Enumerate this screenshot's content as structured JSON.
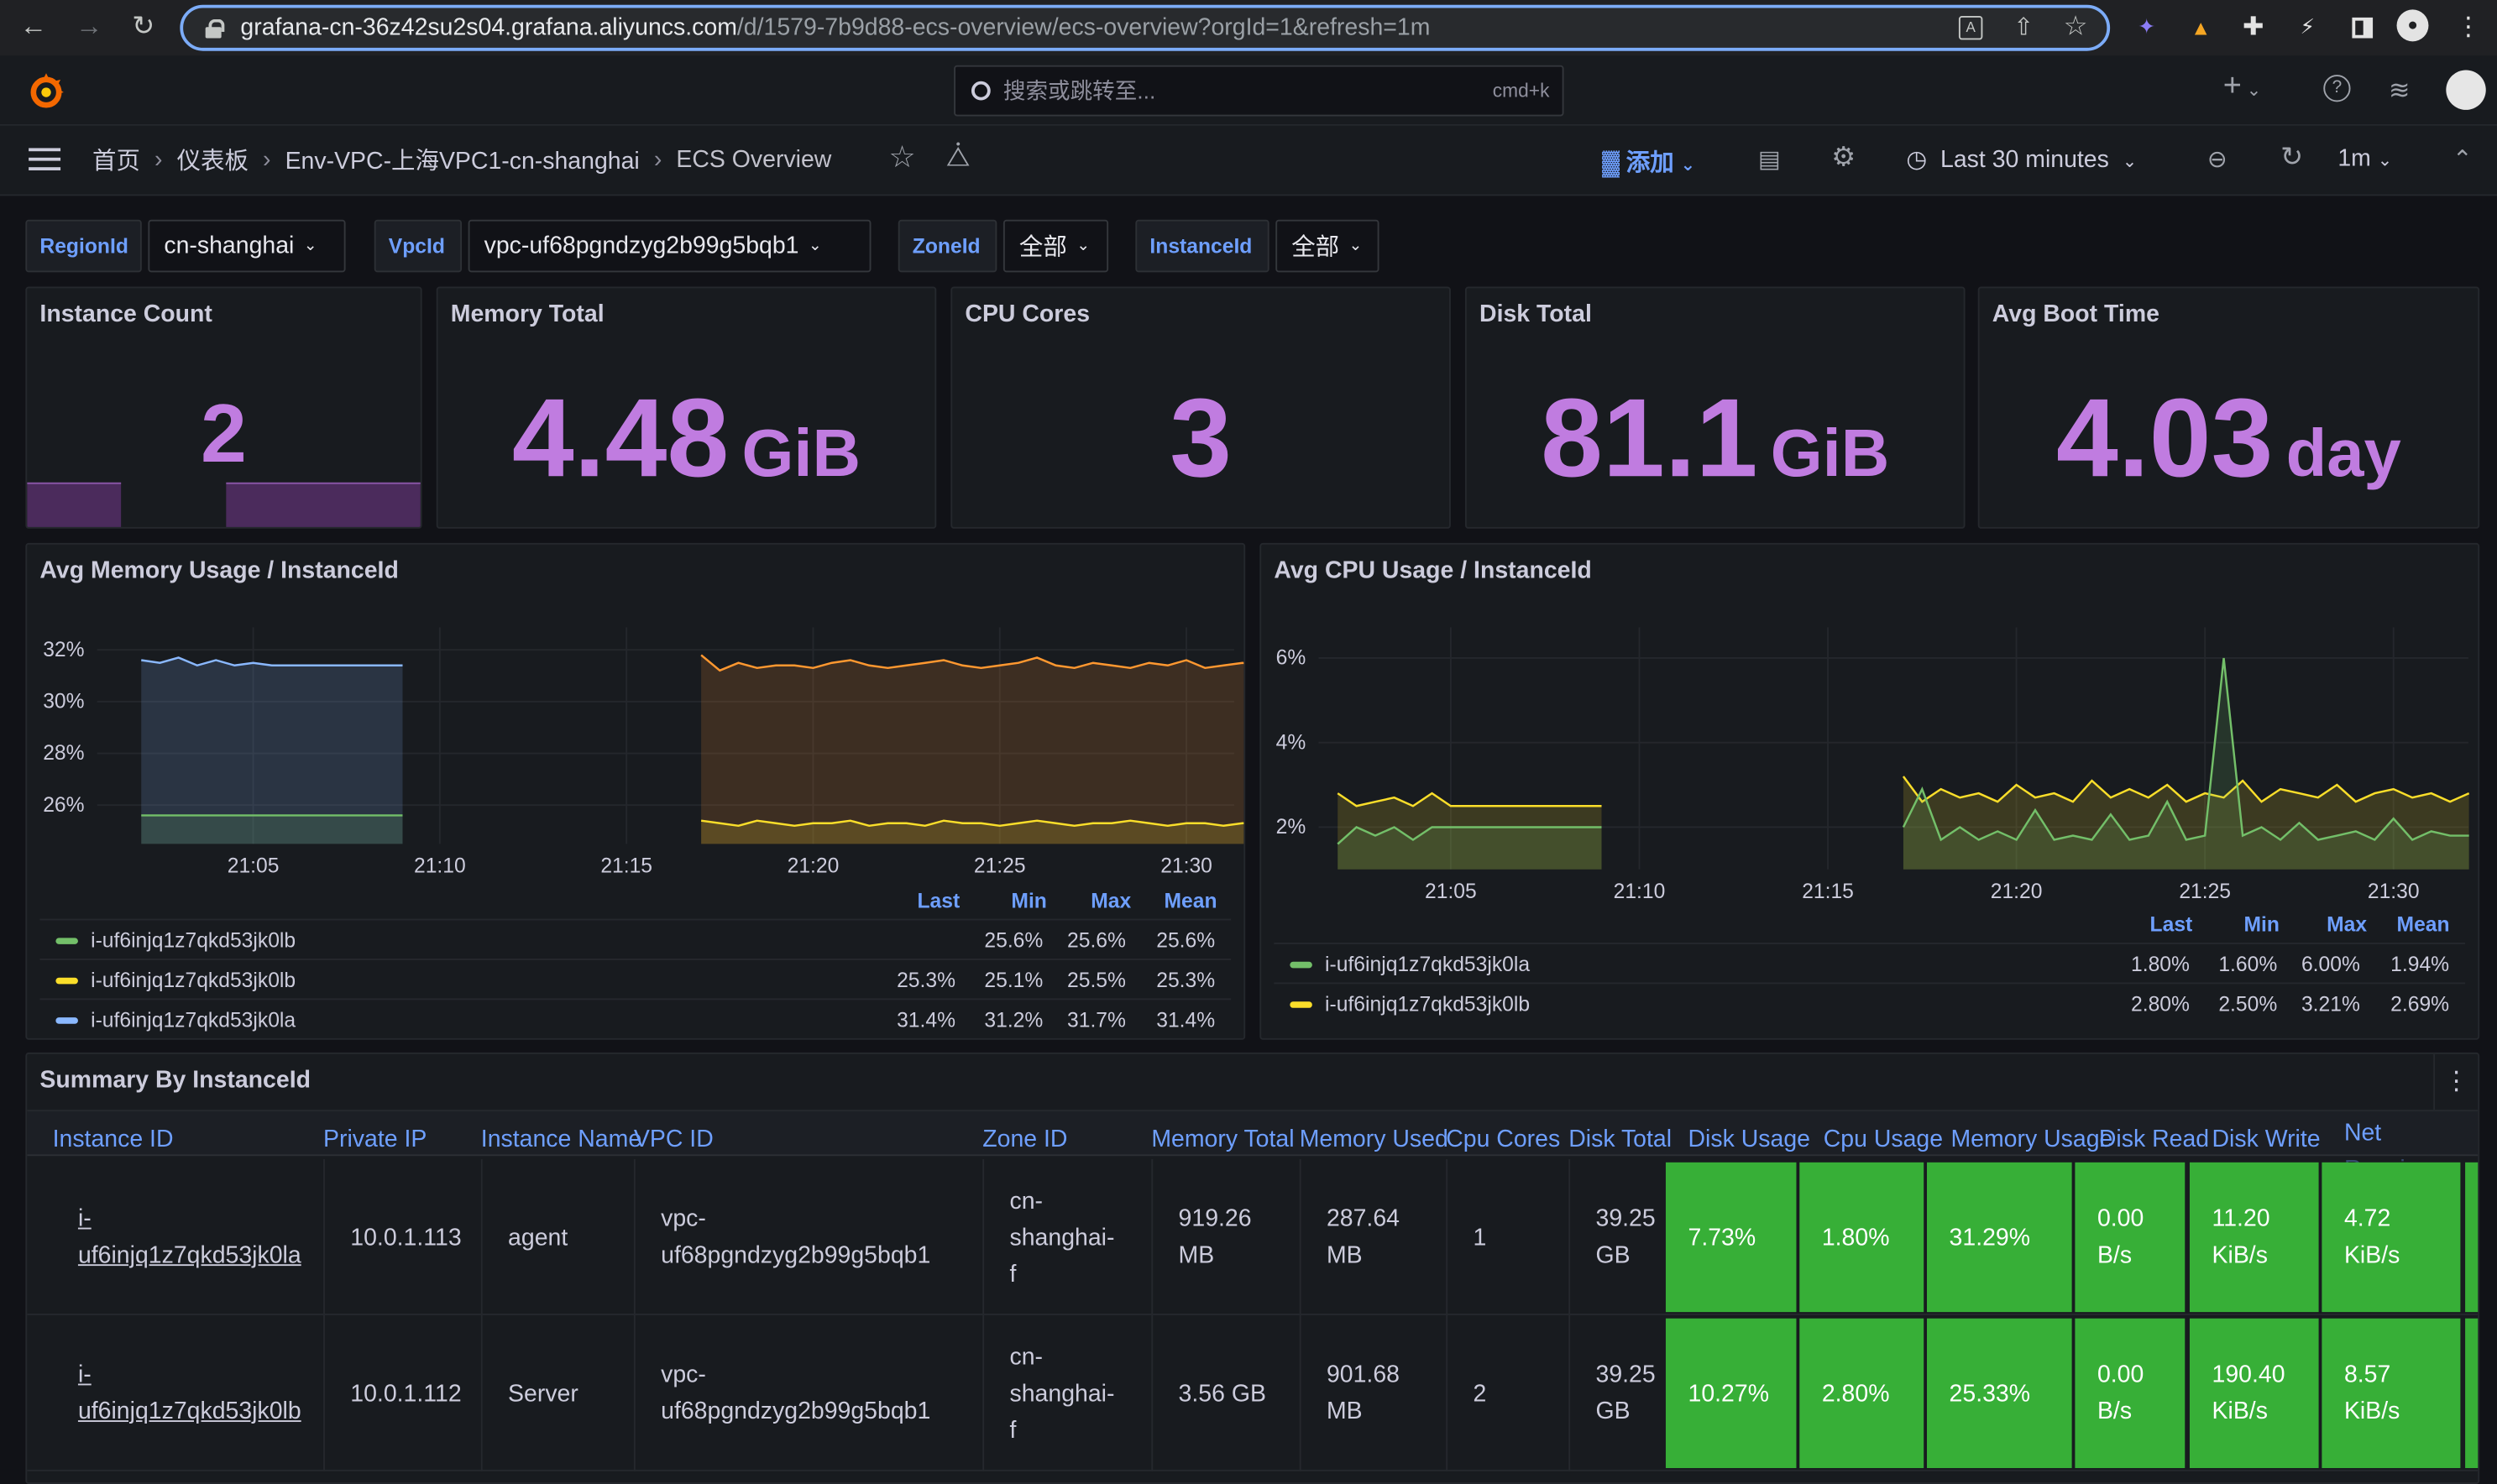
{
  "browser": {
    "url_host": "grafana-cn-36z42su2s04.grafana.aliyuncs.com",
    "url_path": "/d/1579-7b9d88-ecs-overview/ecs-overview?orgId=1&refresh=1m"
  },
  "topbar": {
    "search_placeholder": "搜索或跳转至...",
    "search_shortcut": "cmd+k",
    "new_label": "+"
  },
  "breadcrumb": {
    "home": "首页",
    "dashboards": "仪表板",
    "folder": "Env-VPC-上海VPC1-cn-shanghai",
    "current": "ECS Overview"
  },
  "toolbar": {
    "add_label": "添加",
    "time_range": "Last 30 minutes",
    "refresh_interval": "1m"
  },
  "variables": [
    {
      "label": "RegionId",
      "value": "cn-shanghai"
    },
    {
      "label": "VpcId",
      "value": "vpc-uf68pgndzyg2b99g5bqb1"
    },
    {
      "label": "ZoneId",
      "value": "全部"
    },
    {
      "label": "InstanceId",
      "value": "全部"
    }
  ],
  "stats": {
    "instance_count": {
      "title": "Instance Count",
      "value": "2",
      "unit": ""
    },
    "memory_total": {
      "title": "Memory Total",
      "value": "4.48",
      "unit": "GiB"
    },
    "cpu_cores": {
      "title": "CPU Cores",
      "value": "3",
      "unit": ""
    },
    "disk_total": {
      "title": "Disk Total",
      "value": "81.1",
      "unit": "GiB"
    },
    "avg_boot_time": {
      "title": "Avg Boot Time",
      "value": "4.03",
      "unit": "day"
    }
  },
  "colors": {
    "stat_purple": "#c07ce0",
    "good_green": "#37af37",
    "orange": "#ff9830",
    "yellow": "#fade2a",
    "green": "#73bf69",
    "blue": "#8ab8ff"
  },
  "memory_chart": {
    "title": "Avg Memory Usage / InstanceId",
    "legend_headers": [
      "Last",
      "Min",
      "Max",
      "Mean"
    ],
    "legend": [
      {
        "name": "i-uf6injq1z7qkd53jk0lb",
        "color": "#73bf69",
        "last": "",
        "min": "25.6%",
        "max": "25.6%",
        "mean": "25.6%"
      },
      {
        "name": "i-uf6injq1z7qkd53jk0lb",
        "color": "#fade2a",
        "last": "25.3%",
        "min": "25.1%",
        "max": "25.5%",
        "mean": "25.3%"
      },
      {
        "name": "i-uf6injq1z7qkd53jk0la",
        "color": "#8ab8ff",
        "last": "31.4%",
        "min": "31.2%",
        "max": "31.7%",
        "mean": "31.4%"
      }
    ]
  },
  "cpu_chart": {
    "title": "Avg CPU Usage / InstanceId",
    "legend_headers": [
      "Last",
      "Min",
      "Max",
      "Mean"
    ],
    "legend": [
      {
        "name": "i-uf6injq1z7qkd53jk0la",
        "color": "#73bf69",
        "last": "1.80%",
        "min": "1.60%",
        "max": "6.00%",
        "mean": "1.94%"
      },
      {
        "name": "i-uf6injq1z7qkd53jk0lb",
        "color": "#fade2a",
        "last": "2.80%",
        "min": "2.50%",
        "max": "3.21%",
        "mean": "2.69%"
      }
    ]
  },
  "chart_data": [
    {
      "type": "line",
      "title": "Avg Memory Usage / InstanceId",
      "x_ticks": [
        "21:05",
        "21:10",
        "21:15",
        "21:20",
        "21:25",
        "21:30"
      ],
      "y_ticks": [
        "26%",
        "28%",
        "30%",
        "32%"
      ],
      "ylim": [
        24.5,
        32.5
      ],
      "xlim": [
        21.0,
        21.55
      ],
      "series": [
        {
          "name": "i-uf6injq1z7qkd53jk0la",
          "color": "#8ab8ff",
          "x_range": [
            "21:02",
            "21:09"
          ],
          "values": [
            31.6,
            31.5,
            31.7,
            31.4,
            31.6,
            31.4,
            31.5,
            31.4,
            31.4,
            31.4,
            31.4,
            31.4,
            31.4,
            31.4,
            31.4
          ]
        },
        {
          "name": "i-uf6injq1z7qkd53jk0lb",
          "color": "#73bf69",
          "x_range": [
            "21:02",
            "21:09"
          ],
          "values": [
            25.6,
            25.6,
            25.6,
            25.6,
            25.6,
            25.6,
            25.6,
            25.6,
            25.6,
            25.6,
            25.6,
            25.6,
            25.6,
            25.6,
            25.6
          ]
        },
        {
          "name": "i-uf6injq1z7qkd53jk0lb",
          "color": "#ff9830",
          "x_range": [
            "21:17",
            "21:32"
          ],
          "values": [
            31.8,
            31.2,
            31.5,
            31.3,
            31.4,
            31.4,
            31.3,
            31.5,
            31.6,
            31.4,
            31.3,
            31.4,
            31.5,
            31.6,
            31.4,
            31.3,
            31.4,
            31.5,
            31.7,
            31.4,
            31.3,
            31.5,
            31.4,
            31.3,
            31.5,
            31.4,
            31.6,
            31.3,
            31.4,
            31.5,
            31.4
          ]
        },
        {
          "name": "i-uf6injq1z7qkd53jk0lb",
          "color": "#fade2a",
          "x_range": [
            "21:17",
            "21:32"
          ],
          "values": [
            25.4,
            25.3,
            25.2,
            25.4,
            25.3,
            25.2,
            25.3,
            25.3,
            25.4,
            25.2,
            25.3,
            25.3,
            25.2,
            25.4,
            25.3,
            25.3,
            25.2,
            25.3,
            25.4,
            25.3,
            25.2,
            25.3,
            25.3,
            25.4,
            25.3,
            25.2,
            25.3,
            25.3,
            25.2,
            25.3,
            25.3
          ]
        }
      ]
    },
    {
      "type": "line",
      "title": "Avg CPU Usage / InstanceId",
      "x_ticks": [
        "21:05",
        "21:10",
        "21:15",
        "21:20",
        "21:25",
        "21:30"
      ],
      "y_ticks": [
        "2%",
        "4%",
        "6%"
      ],
      "ylim": [
        1.0,
        6.5
      ],
      "xlim": [
        21.0,
        21.55
      ],
      "series": [
        {
          "name": "i-uf6injq1z7qkd53jk0lb",
          "color": "#fade2a",
          "x_range": [
            "21:02",
            "21:09"
          ],
          "values": [
            2.8,
            2.5,
            2.6,
            2.7,
            2.5,
            2.8,
            2.5,
            2.5,
            2.5,
            2.5,
            2.5,
            2.5,
            2.5,
            2.5,
            2.5
          ]
        },
        {
          "name": "i-uf6injq1z7qkd53jk0la",
          "color": "#73bf69",
          "x_range": [
            "21:02",
            "21:09"
          ],
          "values": [
            1.6,
            2.0,
            1.8,
            2.0,
            1.7,
            2.0,
            2.0,
            2.0,
            2.0,
            2.0,
            2.0,
            2.0,
            2.0,
            2.0,
            2.0
          ]
        },
        {
          "name": "i-uf6injq1z7qkd53jk0lb",
          "color": "#fade2a",
          "x_range": [
            "21:17",
            "21:32"
          ],
          "values": [
            3.2,
            2.6,
            2.9,
            2.7,
            2.8,
            2.6,
            3.0,
            2.7,
            2.8,
            2.6,
            3.1,
            2.7,
            2.9,
            2.7,
            3.0,
            2.6,
            2.8,
            2.7,
            3.1,
            2.6,
            2.9,
            2.8,
            2.7,
            3.0,
            2.6,
            2.8,
            2.9,
            2.7,
            2.8,
            2.6,
            2.8
          ]
        },
        {
          "name": "i-uf6injq1z7qkd53jk0la",
          "color": "#73bf69",
          "x_range": [
            "21:17",
            "21:32"
          ],
          "values": [
            2.0,
            2.9,
            1.7,
            2.0,
            1.7,
            1.9,
            1.7,
            2.4,
            1.7,
            1.8,
            1.7,
            2.3,
            1.7,
            1.8,
            2.6,
            1.7,
            1.8,
            6.0,
            1.8,
            2.0,
            1.7,
            2.1,
            1.7,
            1.8,
            1.9,
            1.7,
            2.2,
            1.7,
            1.9,
            1.8,
            1.8
          ]
        }
      ]
    }
  ],
  "table": {
    "title": "Summary By InstanceId",
    "headers": [
      "Instance ID",
      "Private IP",
      "Instance Name",
      "VPC ID",
      "Zone ID",
      "Memory Total",
      "Memory Used",
      "Cpu Cores",
      "Disk Total",
      "Disk Usage",
      "Cpu Usage",
      "Memory Usage",
      "Disk Read",
      "Disk Write",
      "Net Receive"
    ],
    "rows": [
      {
        "instance_id_a": "i-",
        "instance_id_b": "uf6injq1z7qkd53jk0la",
        "ip": "10.0.1.113",
        "name": "agent",
        "vpc_a": "vpc-",
        "vpc_b": "uf68pgndzyg2b99g5bqb1",
        "zone_a": "cn-",
        "zone_b": "shanghai-",
        "zone_c": "f",
        "mem_total_a": "919.26",
        "mem_total_b": "MB",
        "mem_used_a": "287.64",
        "mem_used_b": "MB",
        "cpu_cores": "1",
        "disk_total_a": "39.25",
        "disk_total_b": "GB",
        "disk_usage": "7.73%",
        "cpu_usage": "1.80%",
        "mem_usage": "31.29%",
        "disk_read_a": "0.00",
        "disk_read_b": "B/s",
        "disk_write_a": "11.20",
        "disk_write_b": "KiB/s",
        "net_recv_a": "4.72",
        "net_recv_b": "KiB/s"
      },
      {
        "instance_id_a": "i-",
        "instance_id_b": "uf6injq1z7qkd53jk0lb",
        "ip": "10.0.1.112",
        "name": "Server",
        "vpc_a": "vpc-",
        "vpc_b": "uf68pgndzyg2b99g5bqb1",
        "zone_a": "cn-",
        "zone_b": "shanghai-",
        "zone_c": "f",
        "mem_total_a": "3.56 GB",
        "mem_total_b": "",
        "mem_used_a": "901.68",
        "mem_used_b": "MB",
        "cpu_cores": "2",
        "disk_total_a": "39.25",
        "disk_total_b": "GB",
        "disk_usage": "10.27%",
        "cpu_usage": "2.80%",
        "mem_usage": "25.33%",
        "disk_read_a": "0.00",
        "disk_read_b": "B/s",
        "disk_write_a": "190.40",
        "disk_write_b": "KiB/s",
        "net_recv_a": "8.57",
        "net_recv_b": "KiB/s"
      }
    ]
  }
}
